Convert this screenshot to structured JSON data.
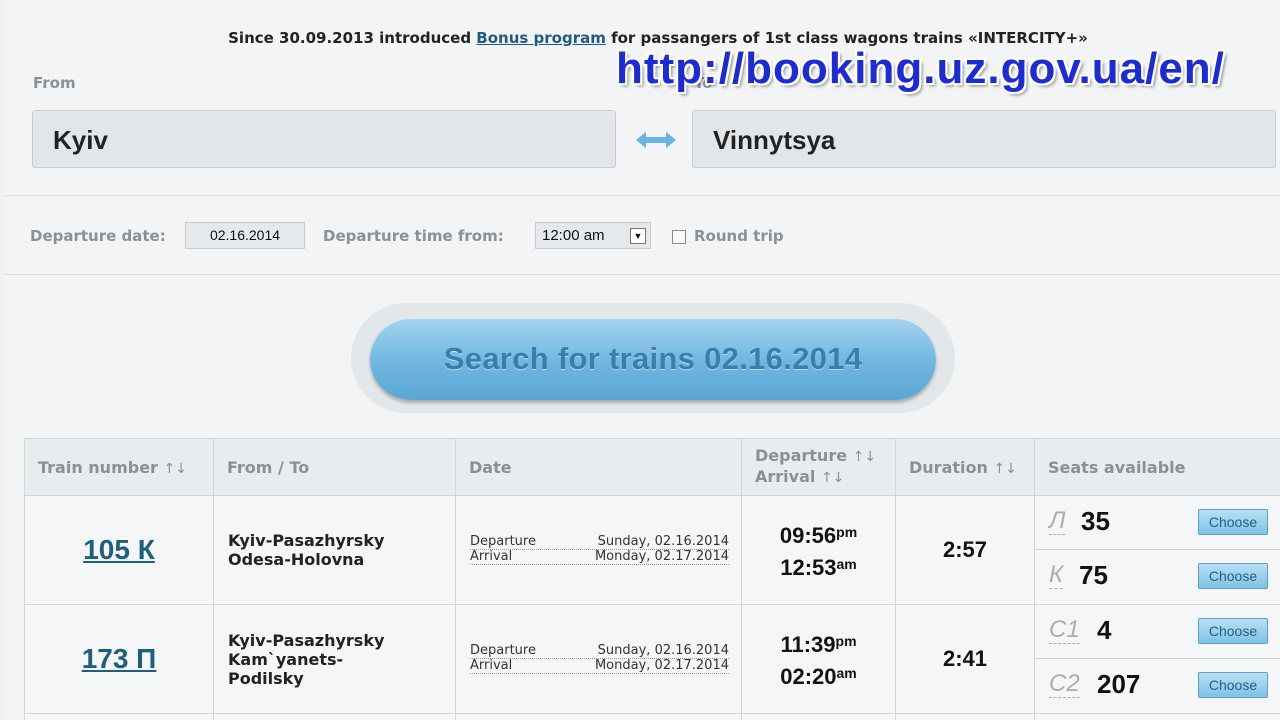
{
  "notice": {
    "before": "Since 30.09.2013 introduced ",
    "link": "Bonus program",
    "after": " for passangers of 1st class wagons trains «INTERCITY+»"
  },
  "watermark": "http://booking.uz.gov.ua/en/",
  "form": {
    "from_label": "From",
    "to_label": "To",
    "from_value": "Kyiv",
    "to_value": "Vinnytsya",
    "swap_icon": "swap-arrows-icon",
    "departure_date_label": "Departure date:",
    "departure_date_value": "02.16.2014",
    "departure_time_label": "Departure time from:",
    "departure_time_value": "12:00 am",
    "round_trip_label": "Round trip",
    "round_trip_checked": false,
    "search_button": "Search for trains 02.16.2014"
  },
  "table": {
    "headers": {
      "train_number": "Train number",
      "from_to": "From / To",
      "date": "Date",
      "departure": "Departure",
      "arrival": "Arrival",
      "duration": "Duration",
      "seats": "Seats available",
      "sort_icon": "↑↓"
    },
    "departure_word": "Departure",
    "arrival_word": "Arrival",
    "choose_label": "Choose",
    "rows": [
      {
        "train": "105 К",
        "route_from": "Kyiv-Pasazhyrsky",
        "route_to": "Odesa-Holovna",
        "departure_date": "Sunday, 02.16.2014",
        "arrival_date": "Monday, 02.17.2014",
        "departure_time": "09:56",
        "departure_ampm": "pm",
        "arrival_time": "12:53",
        "arrival_ampm": "am",
        "duration": "2:57",
        "seats": [
          {
            "class": "Л",
            "count": "35"
          },
          {
            "class": "К",
            "count": "75"
          }
        ]
      },
      {
        "train": "173 П",
        "route_from": "Kyiv-Pasazhyrsky",
        "route_to": "Kam`yanets-Podilsky",
        "departure_date": "Sunday, 02.16.2014",
        "arrival_date": "Monday, 02.17.2014",
        "departure_time": "11:39",
        "departure_ampm": "pm",
        "arrival_time": "02:20",
        "arrival_ampm": "am",
        "duration": "2:41",
        "seats": [
          {
            "class": "С1",
            "count": "4"
          },
          {
            "class": "С2",
            "count": "207"
          }
        ]
      }
    ]
  }
}
